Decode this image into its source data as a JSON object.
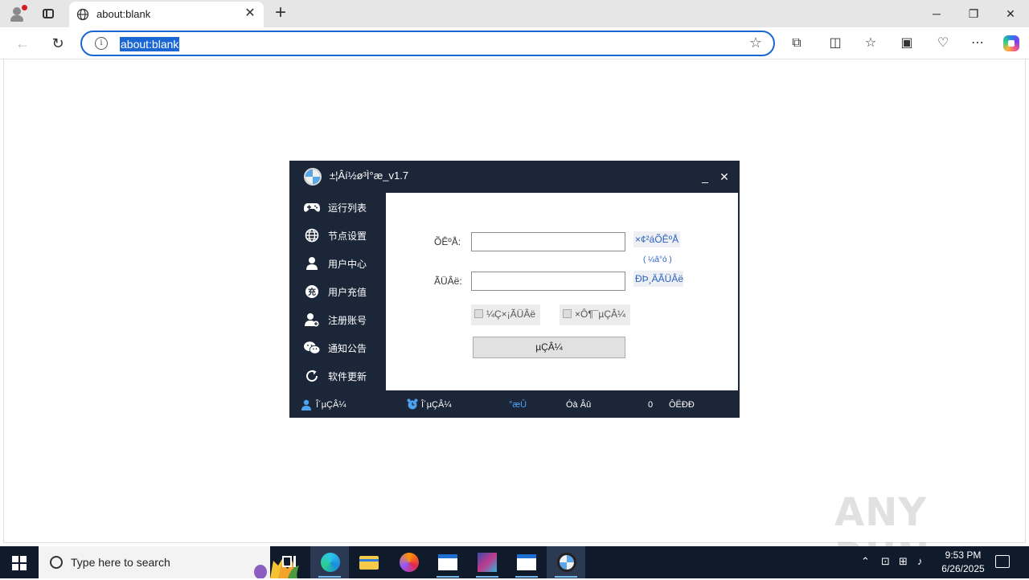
{
  "browser": {
    "tab_title": "about:blank",
    "address": "about:blank"
  },
  "app": {
    "title": "±¦Âí½ø³Ì°æ_v1.7",
    "minimize_label": "_",
    "close_label": "✕",
    "sidebar": [
      {
        "label": "运行列表",
        "icon": "gamepad-icon"
      },
      {
        "label": "节点设置",
        "icon": "globe-icon"
      },
      {
        "label": "用户中心",
        "icon": "user-icon"
      },
      {
        "label": "用户充值",
        "icon": "recharge-icon"
      },
      {
        "label": "注册账号",
        "icon": "user-add-icon"
      },
      {
        "label": "通知公告",
        "icon": "wechat-icon"
      },
      {
        "label": "软件更新",
        "icon": "refresh-icon"
      }
    ],
    "form": {
      "account_label": "ÕÊºÅ:",
      "account_value": "",
      "register_link": "×¢²áÕÊºÅ",
      "register_sub": "( ¼â°ó )",
      "password_label": "ÃÜÂë:",
      "password_value": "",
      "change_password_link": "ÐÞ¸ÄÃÜÂë",
      "remember_label": "¼Ç×¡ÃÜÂë",
      "remember_checked": false,
      "autologin_label": "×Ô¶¯µÇÂ¼",
      "autologin_checked": false,
      "login_button": "µÇÂ¼"
    },
    "status": {
      "user": "Î´µÇÂ¼",
      "time": "Î´µÇÂ¼",
      "item3": "°æÛ",
      "item4": "Óà Âû",
      "count": "0",
      "item6": "ÔËÐÐ"
    }
  },
  "watermark": "ANY RUN",
  "taskbar": {
    "search_placeholder": "Type here to search",
    "time": "9:53 PM",
    "date": "6/26/2025"
  },
  "colors": {
    "app_bg": "#1b2638",
    "accent": "#1a66d2",
    "link": "#2a62c4"
  }
}
